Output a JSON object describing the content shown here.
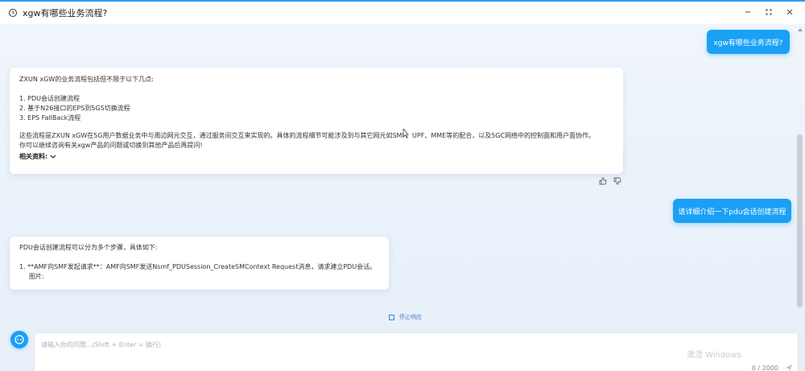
{
  "window": {
    "title": "xgw有哪些业务流程?"
  },
  "messages": {
    "user_1": "xgw有哪些业务流程?",
    "ai_1": {
      "intro": "ZXUN xGW的业务流程包括但不限于以下几点:",
      "list": [
        "1. PDU会话创建流程",
        "2. 基于N26接口的EPS到5GS切换流程",
        "3. EPS FallBack流程"
      ],
      "summary_1": "这些流程是ZXUN xGW在5G用户数据业务中与周边网元交互，通过服务间交互来实现的。具体的流程细节可能涉及到与其它网元如SMF、UPF、MME等的配合，以及5GC网络中的控制面和用户面协作。",
      "summary_2": "你可以继续咨询有关xgw产品的问题或切换到其他产品后再提问!",
      "related_label": "相关资料:"
    },
    "user_2": "请详细介绍一下pdu会话创建流程",
    "ai_2": {
      "intro": "PDU会话创建流程可以分为多个步骤，具体如下:",
      "step_1": "1. **AMF向SMF发起请求**：AMF向SMF发送Nsmf_PDUSession_CreateSMContext Request消息，请求建立PDU会话。",
      "step_1_b": "图片:"
    }
  },
  "controls": {
    "stop_label": "停止响应",
    "input_placeholder": "请输入你的问题...(Shift + Enter = 换行)",
    "counter": "0 / 2000",
    "watermark": "激活 Windows"
  },
  "colors": {
    "accent": "#1aa0f5",
    "titlebar_border": "#2f9bff"
  }
}
